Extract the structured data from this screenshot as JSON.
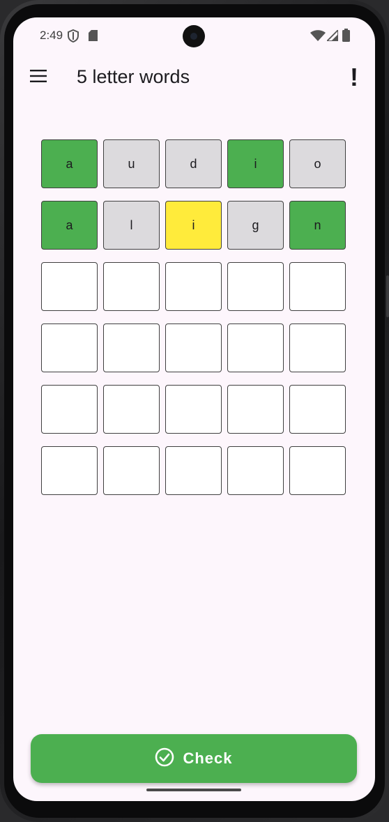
{
  "status_bar": {
    "time": "2:49",
    "icons": [
      "shield-icon",
      "sd-card-icon",
      "wifi-icon",
      "cell-signal-icon",
      "battery-icon"
    ]
  },
  "app_bar": {
    "title": "5 letter words",
    "menu_icon": "hamburger-menu-icon",
    "info_label": "!"
  },
  "board": {
    "rows": [
      [
        {
          "letter": "a",
          "state": "green"
        },
        {
          "letter": "u",
          "state": "gray"
        },
        {
          "letter": "d",
          "state": "gray"
        },
        {
          "letter": "i",
          "state": "green"
        },
        {
          "letter": "o",
          "state": "gray"
        }
      ],
      [
        {
          "letter": "a",
          "state": "green"
        },
        {
          "letter": "l",
          "state": "gray"
        },
        {
          "letter": "i",
          "state": "yellow"
        },
        {
          "letter": "g",
          "state": "gray"
        },
        {
          "letter": "n",
          "state": "green"
        }
      ],
      [
        {
          "letter": "",
          "state": "empty"
        },
        {
          "letter": "",
          "state": "empty"
        },
        {
          "letter": "",
          "state": "empty"
        },
        {
          "letter": "",
          "state": "empty"
        },
        {
          "letter": "",
          "state": "empty"
        }
      ],
      [
        {
          "letter": "",
          "state": "empty"
        },
        {
          "letter": "",
          "state": "empty"
        },
        {
          "letter": "",
          "state": "empty"
        },
        {
          "letter": "",
          "state": "empty"
        },
        {
          "letter": "",
          "state": "empty"
        }
      ],
      [
        {
          "letter": "",
          "state": "empty"
        },
        {
          "letter": "",
          "state": "empty"
        },
        {
          "letter": "",
          "state": "empty"
        },
        {
          "letter": "",
          "state": "empty"
        },
        {
          "letter": "",
          "state": "empty"
        }
      ],
      [
        {
          "letter": "",
          "state": "empty"
        },
        {
          "letter": "",
          "state": "empty"
        },
        {
          "letter": "",
          "state": "empty"
        },
        {
          "letter": "",
          "state": "empty"
        },
        {
          "letter": "",
          "state": "empty"
        }
      ]
    ]
  },
  "check_button": {
    "label": "Check",
    "icon": "check-circle-icon"
  },
  "colors": {
    "correct": "#4caf50",
    "absent": "#dcdadd",
    "present": "#ffeb3b",
    "empty": "#ffffff",
    "background": "#fdf6fc"
  }
}
